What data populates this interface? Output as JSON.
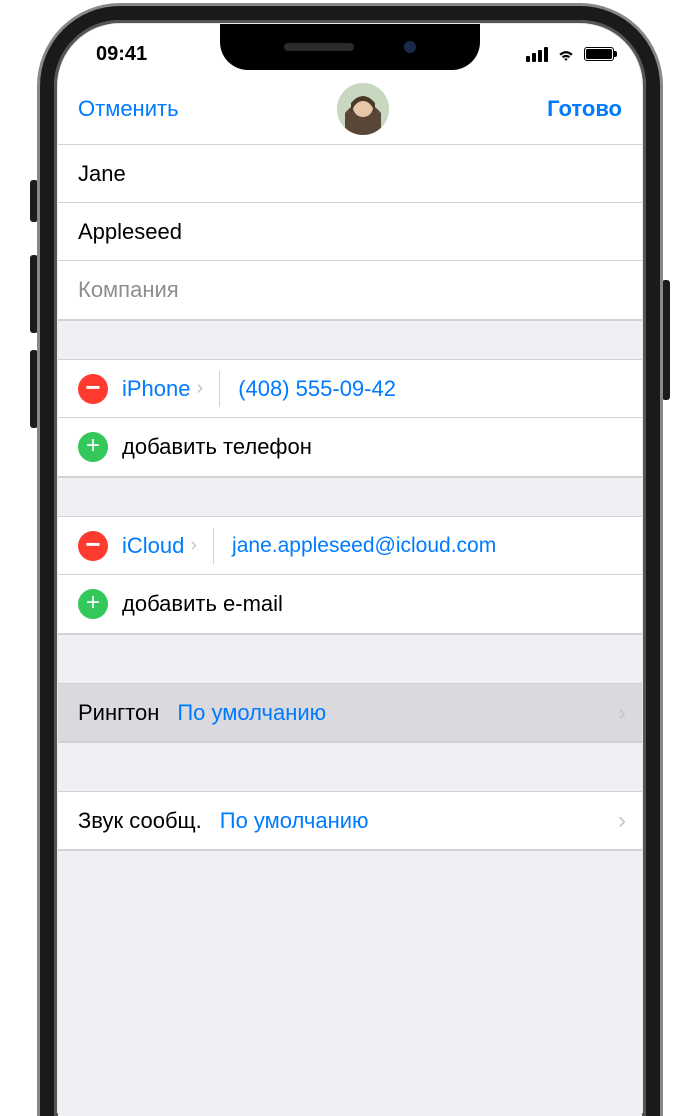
{
  "status": {
    "time": "09:41"
  },
  "nav": {
    "cancel": "Отменить",
    "done": "Готово"
  },
  "name": {
    "first": "Jane",
    "last": "Appleseed",
    "company_placeholder": "Компания"
  },
  "phone": {
    "type": "iPhone",
    "number": "(408) 555-09-42",
    "add": "добавить телефон"
  },
  "email": {
    "type": "iCloud",
    "address": "jane.appleseed@icloud.com",
    "add": "добавить e-mail"
  },
  "ringtone": {
    "label": "Рингтон",
    "value": "По умолчанию"
  },
  "texttone": {
    "label": "Звук сообщ.",
    "value": "По умолчанию"
  }
}
